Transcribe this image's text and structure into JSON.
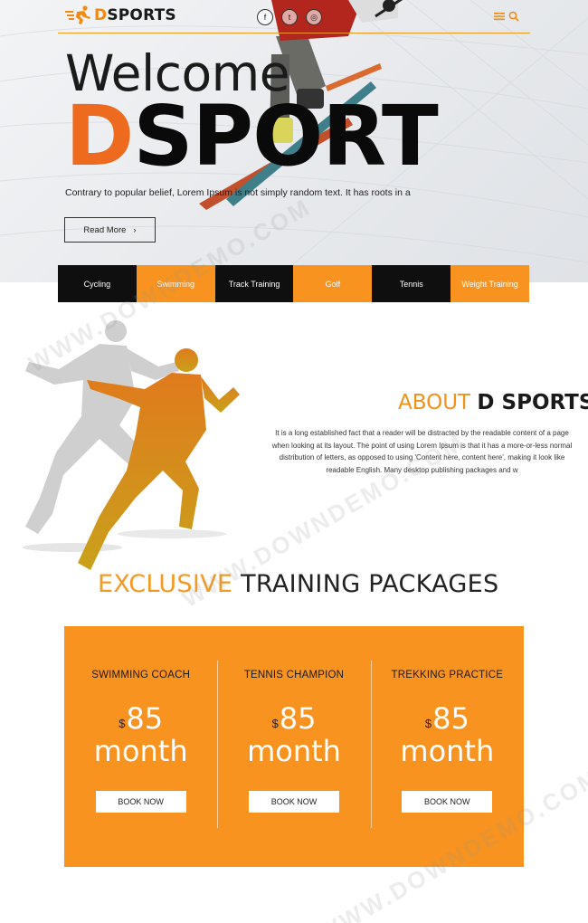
{
  "header": {
    "logo": {
      "letter": "D",
      "rest": "SPORTS",
      "icon": "running-man-icon"
    },
    "socials": [
      {
        "name": "facebook-icon",
        "glyph": "f"
      },
      {
        "name": "twitter-icon",
        "glyph": "t"
      },
      {
        "name": "instagram-icon",
        "glyph": "◎"
      }
    ],
    "tools": [
      "menu-icon",
      "search-icon"
    ]
  },
  "hero": {
    "welcome": "Welcome",
    "title_d": "D",
    "title_rest": "SPORT",
    "text": "Contrary to popular belief, Lorem Ipsum is not simply random text. It has roots in a",
    "read_more": "Read More",
    "read_more_arrow": "›"
  },
  "categories": [
    "Cycling",
    "Swimming",
    "Track Training",
    "Golf",
    "Tennis",
    "Weight Training"
  ],
  "about": {
    "title_hl": "ABOUT",
    "title_rest": "D SPORTS",
    "lines": [
      "It is a long established fact that a reader will be distracted by the readable content of a page",
      "when looking at its layout. The point of using Lorem Ipsum is that it has a more-or-less normal",
      "distribution of letters, as opposed to using 'Content here, content here', making it look like",
      "readable English. Many desktop publishing packages and w"
    ]
  },
  "packages": {
    "title_hl": "EXCLUSIVE",
    "title_rest": "TRAINING PACKAGES",
    "items": [
      {
        "name": "SWIMMING COACH",
        "currency": "$",
        "amount": "85",
        "period": "month",
        "button": "BOOK NOW"
      },
      {
        "name": "TENNIS CHAMPION",
        "currency": "$",
        "amount": "85",
        "period": "month",
        "button": "BOOK NOW"
      },
      {
        "name": "TREKKING PRACTICE",
        "currency": "$",
        "amount": "85",
        "period": "month",
        "button": "BOOK NOW"
      }
    ]
  },
  "colors": {
    "accent": "#f7931e",
    "dark": "#0f0f0f",
    "title_d": "#ee6a1f"
  },
  "watermark": "WWW.DOWNDEMO.COM"
}
